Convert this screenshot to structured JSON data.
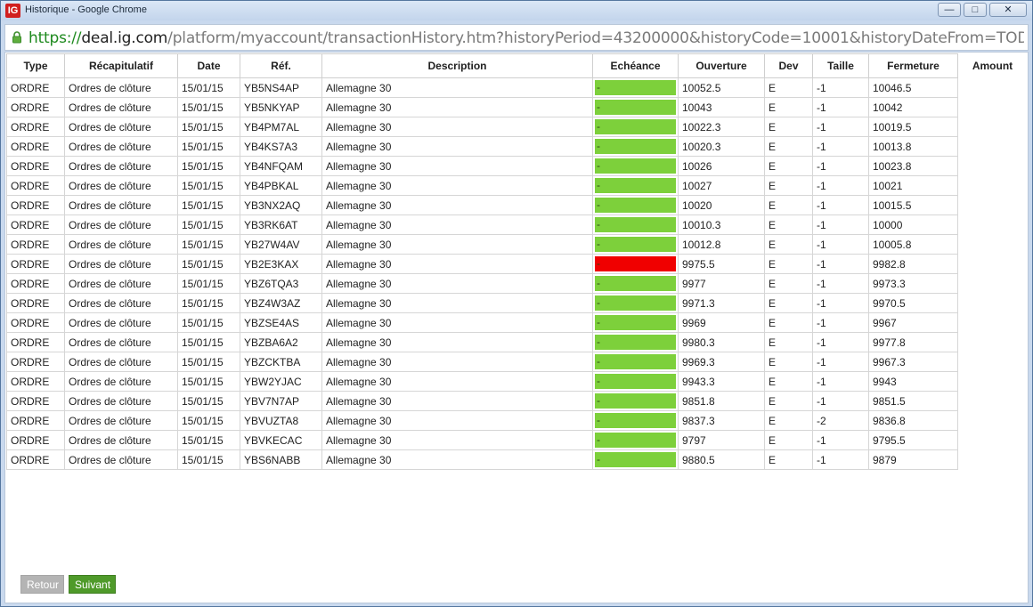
{
  "window": {
    "title": "Historique - Google Chrome",
    "app_icon_text": "IG"
  },
  "window_controls": {
    "minimize": "—",
    "maximize": "□",
    "close": "✕"
  },
  "address": {
    "scheme": "https://",
    "host": "deal.ig.com",
    "path": "/platform/myaccount/transactionHistory.htm?historyPeriod=43200000&historyCode=10001&historyDateFrom=TODAY&historyDateTo=&tr"
  },
  "table": {
    "headers": {
      "type": "Type",
      "recap": "Récapitulatif",
      "date": "Date",
      "ref": "Réf.",
      "description": "Description",
      "echeance": "Echéance",
      "ouverture": "Ouverture",
      "dev": "Dev",
      "taille": "Taille",
      "fermeture": "Fermeture",
      "amount": "Amount"
    },
    "rows": [
      {
        "type": "ORDRE",
        "recap": "Ordres de clôture",
        "date": "15/01/15",
        "ref": "YB5NS4AP",
        "description": "Allemagne 30",
        "echeance": "-",
        "status": "green",
        "ouverture": "10052.5",
        "dev": "E",
        "taille": "-1",
        "fermeture": "10046.5"
      },
      {
        "type": "ORDRE",
        "recap": "Ordres de clôture",
        "date": "15/01/15",
        "ref": "YB5NKYAP",
        "description": "Allemagne 30",
        "echeance": "-",
        "status": "green",
        "ouverture": "10043",
        "dev": "E",
        "taille": "-1",
        "fermeture": "10042"
      },
      {
        "type": "ORDRE",
        "recap": "Ordres de clôture",
        "date": "15/01/15",
        "ref": "YB4PM7AL",
        "description": "Allemagne 30",
        "echeance": "-",
        "status": "green",
        "ouverture": "10022.3",
        "dev": "E",
        "taille": "-1",
        "fermeture": "10019.5"
      },
      {
        "type": "ORDRE",
        "recap": "Ordres de clôture",
        "date": "15/01/15",
        "ref": "YB4KS7A3",
        "description": "Allemagne 30",
        "echeance": "-",
        "status": "green",
        "ouverture": "10020.3",
        "dev": "E",
        "taille": "-1",
        "fermeture": "10013.8"
      },
      {
        "type": "ORDRE",
        "recap": "Ordres de clôture",
        "date": "15/01/15",
        "ref": "YB4NFQAM",
        "description": "Allemagne 30",
        "echeance": "-",
        "status": "green",
        "ouverture": "10026",
        "dev": "E",
        "taille": "-1",
        "fermeture": "10023.8"
      },
      {
        "type": "ORDRE",
        "recap": "Ordres de clôture",
        "date": "15/01/15",
        "ref": "YB4PBKAL",
        "description": "Allemagne 30",
        "echeance": "-",
        "status": "green",
        "ouverture": "10027",
        "dev": "E",
        "taille": "-1",
        "fermeture": "10021"
      },
      {
        "type": "ORDRE",
        "recap": "Ordres de clôture",
        "date": "15/01/15",
        "ref": "YB3NX2AQ",
        "description": "Allemagne 30",
        "echeance": "-",
        "status": "green",
        "ouverture": "10020",
        "dev": "E",
        "taille": "-1",
        "fermeture": "10015.5"
      },
      {
        "type": "ORDRE",
        "recap": "Ordres de clôture",
        "date": "15/01/15",
        "ref": "YB3RK6AT",
        "description": "Allemagne 30",
        "echeance": "-",
        "status": "green",
        "ouverture": "10010.3",
        "dev": "E",
        "taille": "-1",
        "fermeture": "10000"
      },
      {
        "type": "ORDRE",
        "recap": "Ordres de clôture",
        "date": "15/01/15",
        "ref": "YB27W4AV",
        "description": "Allemagne 30",
        "echeance": "-",
        "status": "green",
        "ouverture": "10012.8",
        "dev": "E",
        "taille": "-1",
        "fermeture": "10005.8"
      },
      {
        "type": "ORDRE",
        "recap": "Ordres de clôture",
        "date": "15/01/15",
        "ref": "YB2E3KAX",
        "description": "Allemagne 30",
        "echeance": "-",
        "status": "red",
        "ouverture": "9975.5",
        "dev": "E",
        "taille": "-1",
        "fermeture": "9982.8"
      },
      {
        "type": "ORDRE",
        "recap": "Ordres de clôture",
        "date": "15/01/15",
        "ref": "YBZ6TQA3",
        "description": "Allemagne 30",
        "echeance": "-",
        "status": "green",
        "ouverture": "9977",
        "dev": "E",
        "taille": "-1",
        "fermeture": "9973.3"
      },
      {
        "type": "ORDRE",
        "recap": "Ordres de clôture",
        "date": "15/01/15",
        "ref": "YBZ4W3AZ",
        "description": "Allemagne 30",
        "echeance": "-",
        "status": "green",
        "ouverture": "9971.3",
        "dev": "E",
        "taille": "-1",
        "fermeture": "9970.5"
      },
      {
        "type": "ORDRE",
        "recap": "Ordres de clôture",
        "date": "15/01/15",
        "ref": "YBZSE4AS",
        "description": "Allemagne 30",
        "echeance": "-",
        "status": "green",
        "ouverture": "9969",
        "dev": "E",
        "taille": "-1",
        "fermeture": "9967"
      },
      {
        "type": "ORDRE",
        "recap": "Ordres de clôture",
        "date": "15/01/15",
        "ref": "YBZBA6A2",
        "description": "Allemagne 30",
        "echeance": "-",
        "status": "green",
        "ouverture": "9980.3",
        "dev": "E",
        "taille": "-1",
        "fermeture": "9977.8"
      },
      {
        "type": "ORDRE",
        "recap": "Ordres de clôture",
        "date": "15/01/15",
        "ref": "YBZCKTBA",
        "description": "Allemagne 30",
        "echeance": "-",
        "status": "green",
        "ouverture": "9969.3",
        "dev": "E",
        "taille": "-1",
        "fermeture": "9967.3"
      },
      {
        "type": "ORDRE",
        "recap": "Ordres de clôture",
        "date": "15/01/15",
        "ref": "YBW2YJAC",
        "description": "Allemagne 30",
        "echeance": "-",
        "status": "green",
        "ouverture": "9943.3",
        "dev": "E",
        "taille": "-1",
        "fermeture": "9943"
      },
      {
        "type": "ORDRE",
        "recap": "Ordres de clôture",
        "date": "15/01/15",
        "ref": "YBV7N7AP",
        "description": "Allemagne 30",
        "echeance": "-",
        "status": "green",
        "ouverture": "9851.8",
        "dev": "E",
        "taille": "-1",
        "fermeture": "9851.5"
      },
      {
        "type": "ORDRE",
        "recap": "Ordres de clôture",
        "date": "15/01/15",
        "ref": "YBVUZTA8",
        "description": "Allemagne 30",
        "echeance": "-",
        "status": "green",
        "ouverture": "9837.3",
        "dev": "E",
        "taille": "-2",
        "fermeture": "9836.8"
      },
      {
        "type": "ORDRE",
        "recap": "Ordres de clôture",
        "date": "15/01/15",
        "ref": "YBVKECAC",
        "description": "Allemagne 30",
        "echeance": "-",
        "status": "green",
        "ouverture": "9797",
        "dev": "E",
        "taille": "-1",
        "fermeture": "9795.5"
      },
      {
        "type": "ORDRE",
        "recap": "Ordres de clôture",
        "date": "15/01/15",
        "ref": "YBS6NABB",
        "description": "Allemagne 30",
        "echeance": "-",
        "status": "green",
        "ouverture": "9880.5",
        "dev": "E",
        "taille": "-1",
        "fermeture": "9879"
      }
    ]
  },
  "pagination": {
    "back_label": "Retour",
    "next_label": "Suivant"
  },
  "colors": {
    "green": "#7dd03b",
    "red": "#f00000",
    "next_button": "#4f9a2a",
    "back_button": "#b4b4b4"
  }
}
